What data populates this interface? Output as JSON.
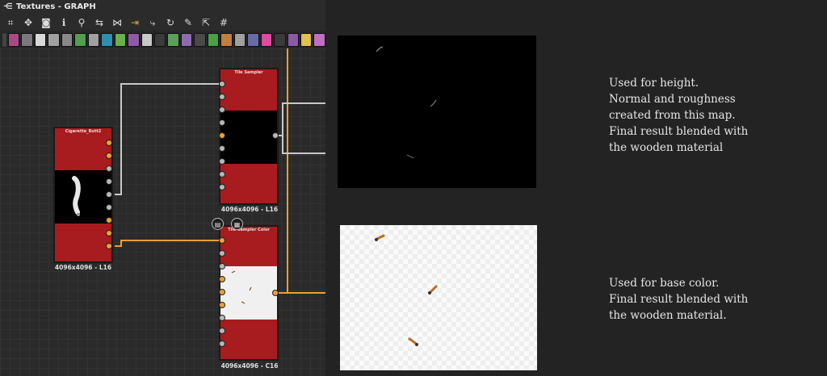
{
  "window": {
    "title": "Textures - GRAPH",
    "title_icon": "graph-icon"
  },
  "toolbar_top": {
    "icons": [
      "frame-icon",
      "move-icon",
      "camera-icon",
      "info-icon",
      "search-icon",
      "link-icon",
      "share-icon",
      "pin-icon",
      "route-icon",
      "refresh-icon",
      "wrench-icon",
      "export-icon",
      "grid-icon"
    ],
    "glyphs": [
      "⌗",
      "✥",
      "◙",
      "ℹ",
      "⚲",
      "⇆",
      "⋈",
      "⇥",
      "⤷",
      "↻",
      "✎",
      "⇱",
      "#"
    ]
  },
  "toolbar_nodes": {
    "colors": [
      "#a84a8a",
      "#7a7a7a",
      "#d8d8d8",
      "#a0a0a0",
      "#888",
      "#4fa04f",
      "#a0a0a0",
      "#2f8fb0",
      "#6ab04c",
      "#8e5aa8",
      "#c8c8c8",
      "#3a3a3a",
      "#5aa05a",
      "#8e6ab0",
      "#4a4a4a",
      "#4aa04a",
      "#c08040",
      "#a0a0a0",
      "#6a6aa8",
      "#e04aa0",
      "#3a3a3a",
      "#8a5aa8",
      "#e0c050",
      "#c070c0"
    ]
  },
  "nodes": {
    "cigarette": {
      "title": "Cigarette_Butt2",
      "resolution": "4096x4096 - L16"
    },
    "tile_sampler": {
      "title": "Tile Sampler",
      "resolution": "4096x4096 - L16"
    },
    "tile_sampler_color": {
      "title": "Tile Sampler Color",
      "resolution": "4096x4096 - C16"
    }
  },
  "node_buttons": {
    "left_icon": "document-icon",
    "right_icon": "checker-icon"
  },
  "captions": {
    "height": "Used for height.\nNormal and roughness\ncreated from this map.\nFinal result blended with\nthe wooden material",
    "base_color": "Used for base color.\nFinal result blended with\nthe wooden material."
  },
  "colors": {
    "node_red": "#a81b1e",
    "wire_orange": "#f0a030",
    "wire_grey": "#c8c8c8"
  }
}
